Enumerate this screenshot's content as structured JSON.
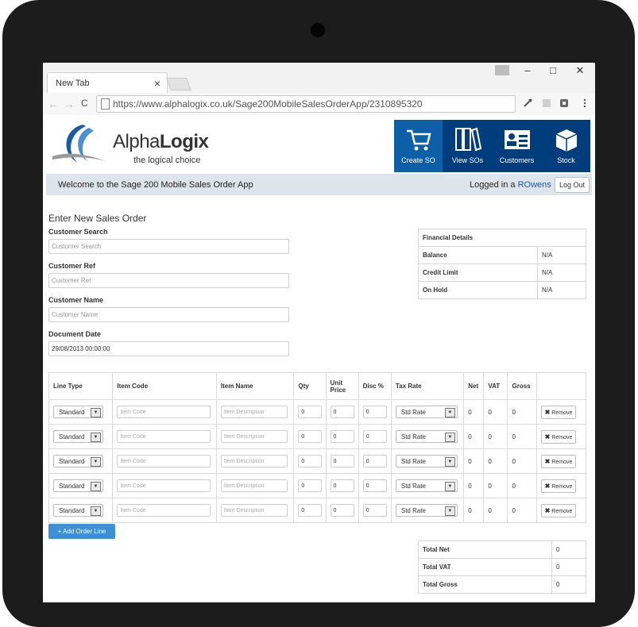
{
  "browser": {
    "tab_title": "New Tab",
    "tab_close": "×",
    "url": "https://www.alphalogix.co.uk/Sage200MobileSalesOrderApp/2310895320",
    "window": {
      "minimize": "–",
      "maximize": "□",
      "close": "✕"
    },
    "nav": {
      "back": "←",
      "forward": "→",
      "reload": "C"
    }
  },
  "brand": {
    "name_light": "Alpha",
    "name_bold": "Logix",
    "tagline": "the logical choice",
    "primary_color": "#003d7c",
    "accent_color": "#3d8fd6"
  },
  "nav_buttons": [
    {
      "label": "Create SO",
      "icon": "cart-icon",
      "active": true
    },
    {
      "label": "View SOs",
      "icon": "binders-icon",
      "active": false
    },
    {
      "label": "Customers",
      "icon": "contact-card-icon",
      "active": false
    },
    {
      "label": "Stock",
      "icon": "box-icon",
      "active": false
    }
  ],
  "welcome": {
    "message": "Welcome to the Sage 200 Mobile Sales Order App",
    "logged_in_prefix": "Logged in a ",
    "user": "ROwens",
    "logout_label": "Log Out"
  },
  "form": {
    "title": "Enter New Sales Order",
    "customer_search": {
      "label": "Customer Search",
      "placeholder": "Customer Search"
    },
    "customer_ref": {
      "label": "Customer Ref",
      "placeholder": "Customer Ref"
    },
    "customer_name": {
      "label": "Customer Name",
      "placeholder": "Customer Name"
    },
    "document_date": {
      "label": "Document Date",
      "value": "29/08/2013 00:00:00"
    }
  },
  "financial": {
    "header": "Financial Details",
    "rows": [
      {
        "label": "Balance",
        "value": "N/A"
      },
      {
        "label": "Credit Limit",
        "value": "N/A"
      },
      {
        "label": "On Hold",
        "value": "N/A"
      }
    ]
  },
  "lines": {
    "headers": [
      "Line Type",
      "Item Code",
      "Item Name",
      "Qty",
      "Unit Price",
      "Disc %",
      "Tax Rate",
      "Net",
      "VAT",
      "Gross",
      ""
    ],
    "rows": [
      {
        "line_type": "Standard",
        "item_code_ph": "Item Code",
        "item_name_ph": "Item Description",
        "qty": "0",
        "unit_price": "0",
        "disc": "0",
        "tax_rate": "Std Rate",
        "net": "0",
        "vat": "0",
        "gross": "0",
        "remove": "Remove"
      },
      {
        "line_type": "Standard",
        "item_code_ph": "Item Code",
        "item_name_ph": "Item Description",
        "qty": "0",
        "unit_price": "0",
        "disc": "0",
        "tax_rate": "Std Rate",
        "net": "0",
        "vat": "0",
        "gross": "0",
        "remove": "Remove"
      },
      {
        "line_type": "Standard",
        "item_code_ph": "Item Code",
        "item_name_ph": "Item Description",
        "qty": "0",
        "unit_price": "0",
        "disc": "0",
        "tax_rate": "Std Rate",
        "net": "0",
        "vat": "0",
        "gross": "0",
        "remove": "Remove"
      },
      {
        "line_type": "Standard",
        "item_code_ph": "Item Code",
        "item_name_ph": "Item Description",
        "qty": "0",
        "unit_price": "0",
        "disc": "0",
        "tax_rate": "Std Rate",
        "net": "0",
        "vat": "0",
        "gross": "0",
        "remove": "Remove"
      },
      {
        "line_type": "Standard",
        "item_code_ph": "Item Code",
        "item_name_ph": "Item Description",
        "qty": "0",
        "unit_price": "0",
        "disc": "0",
        "tax_rate": "Std Rate",
        "net": "0",
        "vat": "0",
        "gross": "0",
        "remove": "Remove"
      }
    ],
    "add_label": "+ Add Order Line"
  },
  "totals": [
    {
      "label": "Total Net",
      "value": "0"
    },
    {
      "label": "Total VAT",
      "value": "0"
    },
    {
      "label": "Total Gross",
      "value": "0"
    }
  ]
}
